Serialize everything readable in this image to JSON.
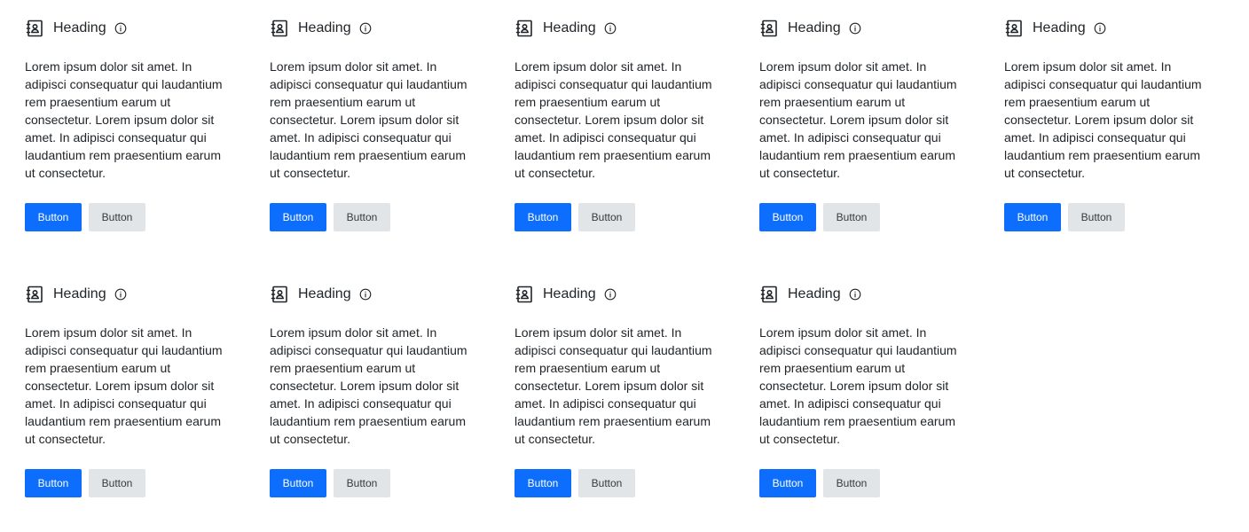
{
  "colors": {
    "primary": "#0d6efd",
    "secondary": "#e2e5e8",
    "text": "#212529"
  },
  "cards": [
    {
      "heading": "Heading",
      "body": "Lorem ipsum dolor sit amet. In adipisci consequatur qui laudantium rem praesentium earum ut consectetur. Lorem ipsum dolor sit amet. In adipisci consequatur qui laudantium rem praesentium earum ut consectetur.",
      "primary_label": "Button",
      "secondary_label": "Button",
      "icon": "contact-book-icon",
      "info_icon": "info-icon"
    },
    {
      "heading": "Heading",
      "body": "Lorem ipsum dolor sit amet. In adipisci consequatur qui laudantium rem praesentium earum ut consectetur. Lorem ipsum dolor sit amet. In adipisci consequatur qui laudantium rem praesentium earum ut consectetur.",
      "primary_label": "Button",
      "secondary_label": "Button",
      "icon": "contact-book-icon",
      "info_icon": "info-icon"
    },
    {
      "heading": "Heading",
      "body": "Lorem ipsum dolor sit amet. In adipisci consequatur qui laudantium rem praesentium earum ut consectetur. Lorem ipsum dolor sit amet. In adipisci consequatur qui laudantium rem praesentium earum ut consectetur.",
      "primary_label": "Button",
      "secondary_label": "Button",
      "icon": "contact-book-icon",
      "info_icon": "info-icon"
    },
    {
      "heading": "Heading",
      "body": "Lorem ipsum dolor sit amet. In adipisci consequatur qui laudantium rem praesentium earum ut consectetur. Lorem ipsum dolor sit amet. In adipisci consequatur qui laudantium rem praesentium earum ut consectetur.",
      "primary_label": "Button",
      "secondary_label": "Button",
      "icon": "contact-book-icon",
      "info_icon": "info-icon"
    },
    {
      "heading": "Heading",
      "body": "Lorem ipsum dolor sit amet. In adipisci consequatur qui laudantium rem praesentium earum ut consectetur. Lorem ipsum dolor sit amet. In adipisci consequatur qui laudantium rem praesentium earum ut consectetur.",
      "primary_label": "Button",
      "secondary_label": "Button",
      "icon": "contact-book-icon",
      "info_icon": "info-icon"
    },
    {
      "heading": "Heading",
      "body": "Lorem ipsum dolor sit amet. In adipisci consequatur qui laudantium rem praesentium earum ut consectetur. Lorem ipsum dolor sit amet. In adipisci consequatur qui laudantium rem praesentium earum ut consectetur.",
      "primary_label": "Button",
      "secondary_label": "Button",
      "icon": "contact-book-icon",
      "info_icon": "info-icon"
    },
    {
      "heading": "Heading",
      "body": "Lorem ipsum dolor sit amet. In adipisci consequatur qui laudantium rem praesentium earum ut consectetur. Lorem ipsum dolor sit amet. In adipisci consequatur qui laudantium rem praesentium earum ut consectetur.",
      "primary_label": "Button",
      "secondary_label": "Button",
      "icon": "contact-book-icon",
      "info_icon": "info-icon"
    },
    {
      "heading": "Heading",
      "body": "Lorem ipsum dolor sit amet. In adipisci consequatur qui laudantium rem praesentium earum ut consectetur. Lorem ipsum dolor sit amet. In adipisci consequatur qui laudantium rem praesentium earum ut consectetur.",
      "primary_label": "Button",
      "secondary_label": "Button",
      "icon": "contact-book-icon",
      "info_icon": "info-icon"
    },
    {
      "heading": "Heading",
      "body": "Lorem ipsum dolor sit amet. In adipisci consequatur qui laudantium rem praesentium earum ut consectetur. Lorem ipsum dolor sit amet. In adipisci consequatur qui laudantium rem praesentium earum ut consectetur.",
      "primary_label": "Button",
      "secondary_label": "Button",
      "icon": "contact-book-icon",
      "info_icon": "info-icon"
    }
  ]
}
